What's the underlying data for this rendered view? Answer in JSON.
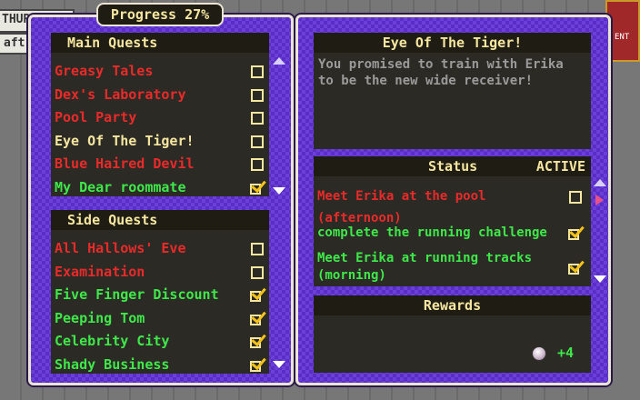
{
  "background": {
    "time_label": "THURSDAY",
    "time_label_2": "aft"
  },
  "progress": {
    "label": "Progress 27%",
    "percent": 27
  },
  "main_quests": {
    "title": "Main Quests",
    "items": [
      {
        "label": "Greasy Tales",
        "color": "red",
        "done": false
      },
      {
        "label": "Dex's Laboratory",
        "color": "red",
        "done": false
      },
      {
        "label": "Pool Party",
        "color": "red",
        "done": false
      },
      {
        "label": "Eye Of The Tiger!",
        "color": "yellow",
        "done": false
      },
      {
        "label": "Blue Haired Devil",
        "color": "red",
        "done": false
      },
      {
        "label": "My Dear roommate",
        "color": "green",
        "done": true
      }
    ]
  },
  "side_quests": {
    "title": "Side Quests",
    "items": [
      {
        "label": "All Hallows' Eve",
        "color": "red",
        "done": false
      },
      {
        "label": "Examination",
        "color": "red",
        "done": false
      },
      {
        "label": "Five Finger Discount",
        "color": "green",
        "done": true
      },
      {
        "label": "Peeping Tom",
        "color": "green",
        "done": true
      },
      {
        "label": "Celebrity City",
        "color": "green",
        "done": true
      },
      {
        "label": "Shady Business",
        "color": "green",
        "done": true
      }
    ]
  },
  "detail": {
    "title": "Eye Of The Tiger!",
    "description": "You promised to train with Erika to be the new wide receiver!"
  },
  "status": {
    "title": "Status",
    "state": "ACTIVE",
    "items": [
      {
        "label": "Meet Erika at the pool (afternoon)",
        "color": "red",
        "done": false
      },
      {
        "label": "complete the running challenge",
        "color": "green",
        "done": true
      },
      {
        "label": "Meet Erika at running tracks (morning)",
        "color": "green",
        "done": true
      }
    ]
  },
  "rewards": {
    "title": "Rewards",
    "amount": "+4",
    "icon": "orb-icon"
  },
  "colors": {
    "red": "#e82a2a",
    "yellow": "#f5e6a0",
    "green": "#3ee84a",
    "panel_purple": "#6a40d8"
  }
}
